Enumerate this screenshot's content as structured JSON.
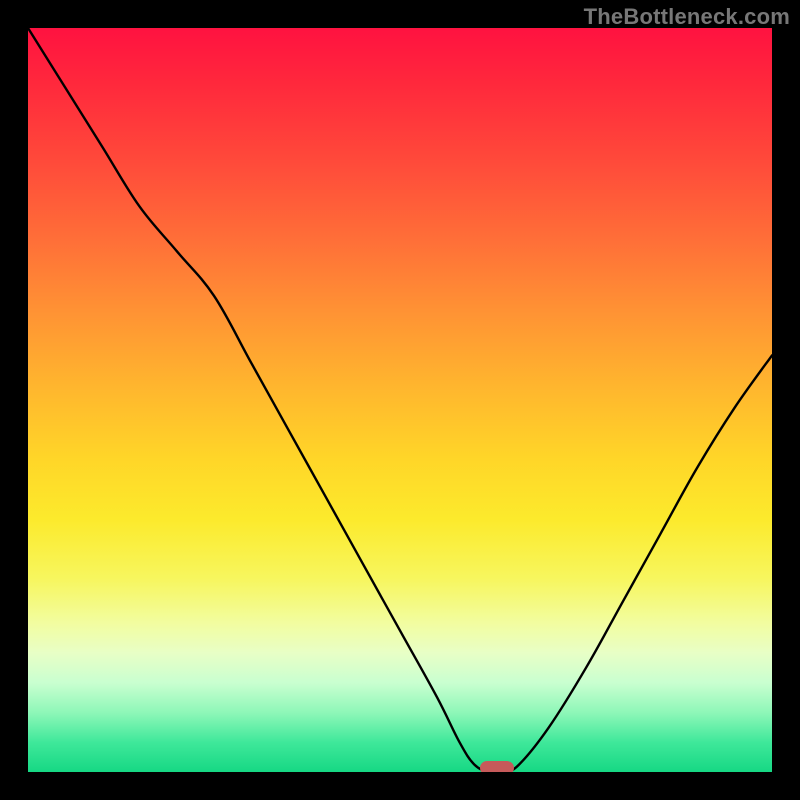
{
  "watermark": "TheBottleneck.com",
  "chart_data": {
    "type": "line",
    "title": "",
    "xlabel": "",
    "ylabel": "",
    "xlim": [
      0,
      100
    ],
    "ylim": [
      0,
      100
    ],
    "grid": false,
    "legend": false,
    "series": [
      {
        "name": "bottleneck-curve",
        "x": [
          0,
          5,
          10,
          15,
          20,
          25,
          30,
          35,
          40,
          45,
          50,
          55,
          58,
          60,
          62,
          64,
          66,
          70,
          75,
          80,
          85,
          90,
          95,
          100
        ],
        "y": [
          100,
          92,
          84,
          76,
          70,
          64,
          55,
          46,
          37,
          28,
          19,
          10,
          4,
          1,
          0,
          0,
          1,
          6,
          14,
          23,
          32,
          41,
          49,
          56
        ]
      }
    ],
    "marker": {
      "x": 63,
      "y": 0.5,
      "name": "optimal-point"
    },
    "background_gradient": {
      "top": "#ff1240",
      "mid": "#ffe22c",
      "bottom": "#16d884"
    }
  }
}
